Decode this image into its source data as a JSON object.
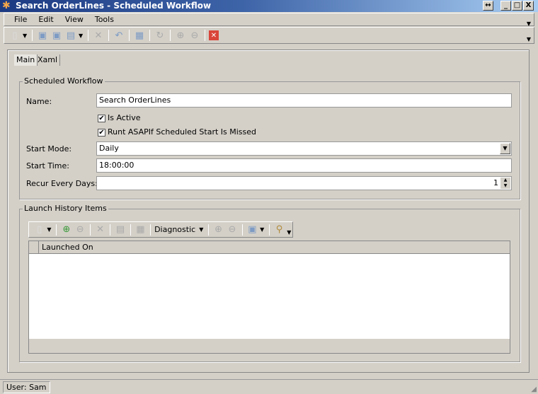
{
  "window": {
    "title": "Search OrderLines - Scheduled Workflow",
    "restore": "↔",
    "minimize": "_",
    "maximize": "□",
    "close": "X"
  },
  "menu": [
    "File",
    "Edit",
    "View",
    "Tools"
  ],
  "tabs": [
    "Main",
    "Xaml"
  ],
  "scheduled": {
    "group_label": "Scheduled Workflow",
    "name_label": "Name:",
    "name_value": "Search OrderLines",
    "is_active_label": "Is Active",
    "is_active": true,
    "runt_label": "Runt ASAPIf Scheduled Start Is Missed",
    "runt": true,
    "start_mode_label": "Start Mode:",
    "start_mode_value": "Daily",
    "start_time_label": "Start Time:",
    "start_time_value": "18:00:00",
    "recur_label": "Recur Every Days:",
    "recur_value": "1"
  },
  "history": {
    "group_label": "Launch History Items",
    "diagnostic_label": "Diagnostic",
    "columns": [
      "Launched On"
    ],
    "rows": []
  },
  "status": {
    "user": "User: Sam"
  }
}
